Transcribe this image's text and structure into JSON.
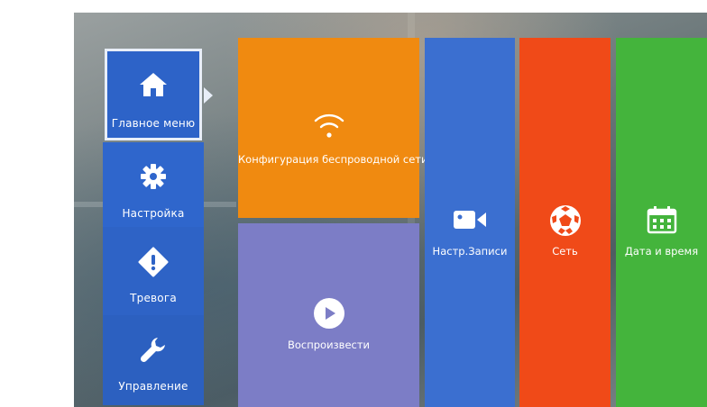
{
  "sidebar": {
    "items": [
      {
        "label": "Главное меню",
        "icon": "home-icon"
      },
      {
        "label": "Настройка",
        "icon": "gear-icon"
      },
      {
        "label": "Тревога",
        "icon": "alert-icon"
      },
      {
        "label": "Управление",
        "icon": "wrench-icon"
      }
    ]
  },
  "tiles": {
    "wifi": {
      "label": "Конфигурация беспроводной сети",
      "icon": "wifi-icon",
      "color": "#f08a10"
    },
    "playback": {
      "label": "Воспроизвести",
      "icon": "play-icon",
      "color": "#7c7dc6"
    },
    "record": {
      "label": "Настр.Записи",
      "icon": "camera-icon",
      "color": "#3b6fd0"
    },
    "network": {
      "label": "Сеть",
      "icon": "network-ball-icon",
      "color": "#f04a18"
    },
    "datetime": {
      "label": "Дата и время",
      "icon": "calendar-icon",
      "color": "#44b43c"
    }
  },
  "colors": {
    "sidebar": "#2d63c8",
    "selected_border": "#e8eef8"
  }
}
